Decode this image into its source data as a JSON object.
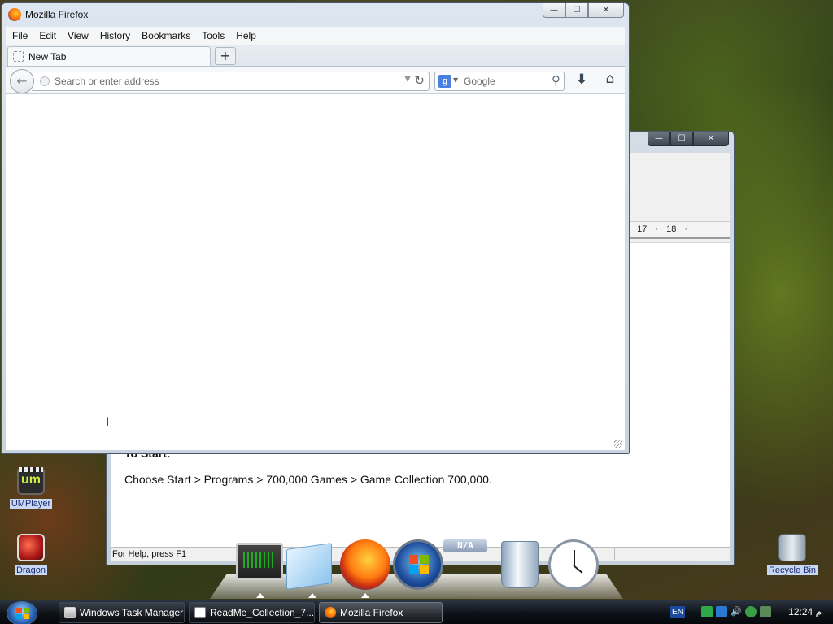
{
  "desktop": {
    "icons": [
      {
        "label": "UMPlayer",
        "glyph": "um"
      },
      {
        "label": "Dragon"
      },
      {
        "label": "Recycle Bin"
      }
    ]
  },
  "readme_window": {
    "ruler_numbers": [
      "17",
      "18"
    ],
    "heading": "To Start:",
    "body_text": "Choose Start > Programs > 700,000 Games > Game Collection 700,000.",
    "status_text": "For Help, press F1",
    "caption": {
      "minimize": "—",
      "maximize": "☐",
      "close": "✕"
    }
  },
  "firefox_window": {
    "title": "Mozilla Firefox",
    "caption": {
      "minimize": "—",
      "maximize": "☐",
      "close": "✕"
    },
    "menu": [
      "File",
      "Edit",
      "View",
      "History",
      "Bookmarks",
      "Tools",
      "Help"
    ],
    "tab_label": "New Tab",
    "new_tab_glyph": "+",
    "back_glyph": "←",
    "url_placeholder": "Search or enter address",
    "url_dropdown_glyph": "▼",
    "reload_glyph": "↻",
    "search_engine_glyph": "g",
    "search_placeholder": "Google",
    "search_glyph": "⚲",
    "download_glyph": "⬇",
    "home_glyph": "⌂",
    "cursor_glyph": "I"
  },
  "dock": {
    "na_label": "N/A"
  },
  "taskbar": {
    "buttons": [
      {
        "label": "Windows Task Manager",
        "icon": "task-manager-icon"
      },
      {
        "label": "ReadMe_Collection_7...",
        "icon": "document-icon"
      },
      {
        "label": "Mozilla Firefox",
        "icon": "firefox-icon",
        "active": true
      }
    ],
    "language": "EN",
    "clock": "12:24 م"
  },
  "colors": {
    "taskbar": "#0e1218",
    "firefox_orange": "#ff6a00",
    "windows_blue": "#1d4c9c"
  }
}
